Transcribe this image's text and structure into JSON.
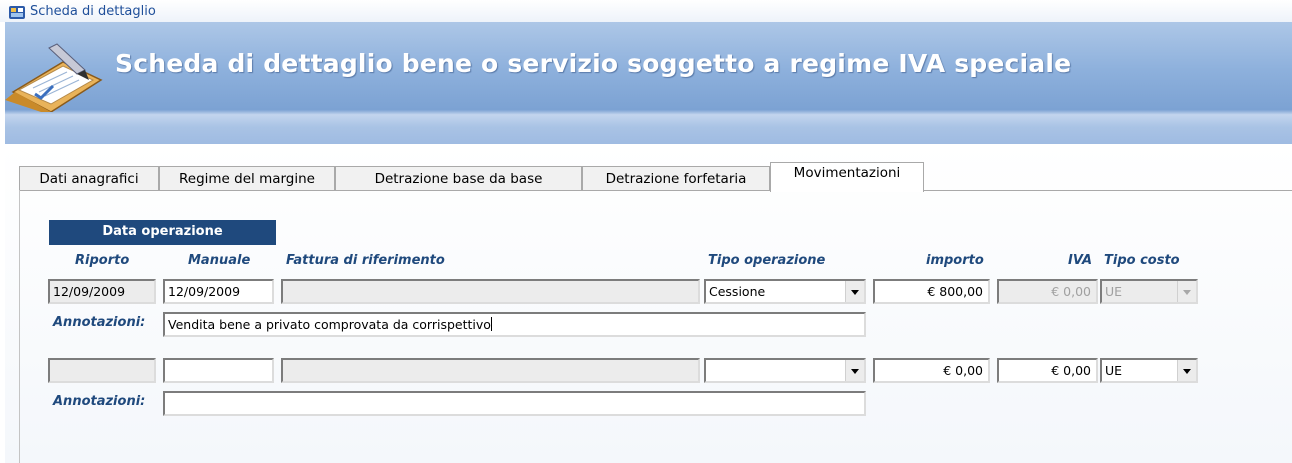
{
  "window": {
    "title": "Scheda di dettaglio"
  },
  "banner": {
    "title": "Scheda di dettaglio bene o servizio soggetto a regime IVA speciale"
  },
  "tabs": [
    {
      "label": "Dati anagrafici"
    },
    {
      "label": "Regime del margine"
    },
    {
      "label": "Detrazione base da base"
    },
    {
      "label": "Detrazione forfetaria"
    },
    {
      "label": "Movimentazioni",
      "active": true
    }
  ],
  "form": {
    "group_header": "Data operazione",
    "columns": {
      "riporto": "Riporto",
      "manuale": "Manuale",
      "fattura": "Fattura di riferimento",
      "tipo_operazione": "Tipo operazione",
      "importo": "importo",
      "iva": "IVA",
      "tipo_costo": "Tipo costo"
    },
    "annotation_label": "Annotazioni:",
    "rows": [
      {
        "riporto": "12/09/2009",
        "manuale": "12/09/2009",
        "fattura": "",
        "tipo_operazione": "Cessione",
        "importo": "€ 800,00",
        "iva": "€ 0,00",
        "tipo_costo": "UE",
        "annotazioni": "Vendita bene a privato comprovata da corrispettivo"
      },
      {
        "riporto": "",
        "manuale": "",
        "fattura": "",
        "tipo_operazione": "",
        "importo": "€ 0,00",
        "iva": "€ 0,00",
        "tipo_costo": "UE",
        "annotazioni": ""
      }
    ]
  },
  "icons": {
    "app": "app-window-icon",
    "banner": "clipboard-pencil-icon",
    "dropdown": "chevron-down-icon"
  }
}
